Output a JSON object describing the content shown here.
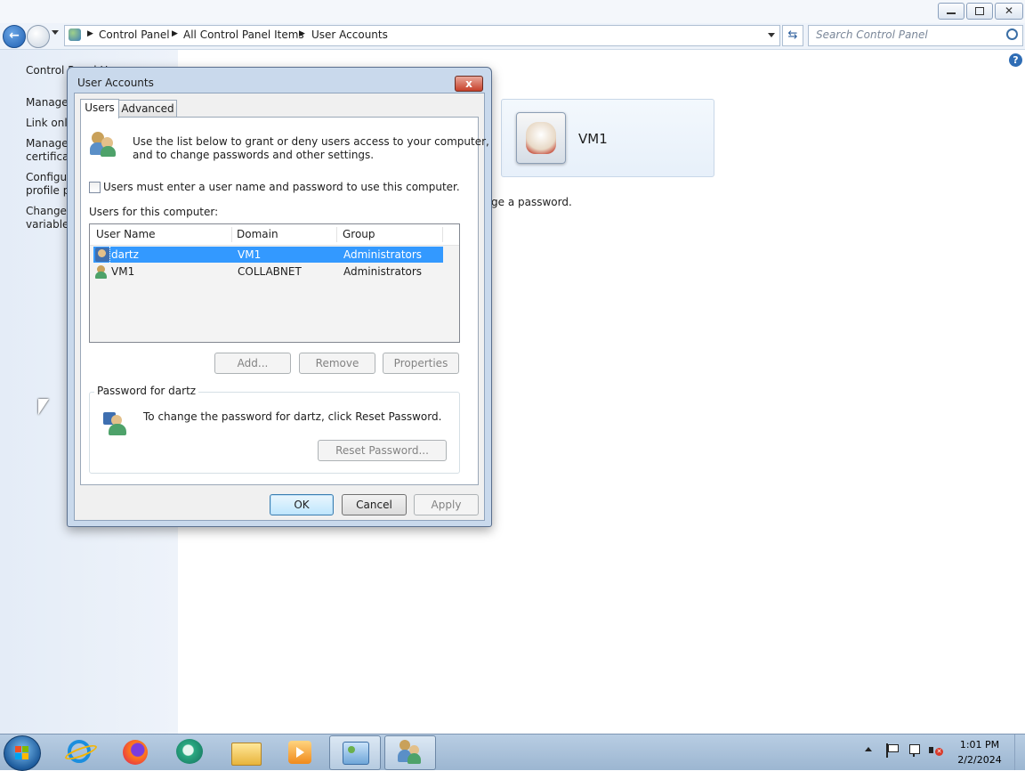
{
  "address": {
    "crumbs": [
      "Control Panel",
      "All Control Panel Items",
      "User Accounts"
    ],
    "search_placeholder": "Search Control Panel"
  },
  "left_pane": {
    "items": [
      "Control Panel Home",
      "Manage",
      "Link onli",
      "Manage",
      "certificat",
      "Configur",
      "profile pr",
      "Change",
      "variables"
    ]
  },
  "main": {
    "account_name": "VM1",
    "change_password_fragment": "ge a password."
  },
  "dialog": {
    "title": "User Accounts",
    "close_label": "x",
    "tabs": [
      "Users",
      "Advanced"
    ],
    "intro_line1": "Use the list below to grant or deny users access to your computer,",
    "intro_line2": "and to change passwords and other settings.",
    "require_login_label": "Users must enter a user name and password to use this computer.",
    "require_login_checked": false,
    "users_label": "Users for this computer:",
    "columns": [
      "User Name",
      "Domain",
      "Group"
    ],
    "users": [
      {
        "name": "dartz",
        "domain": "VM1",
        "group": "Administrators",
        "selected": true
      },
      {
        "name": "VM1",
        "domain": "COLLABNET",
        "group": "Administrators",
        "selected": false
      }
    ],
    "buttons": {
      "add": "Add...",
      "remove": "Remove",
      "properties": "Properties"
    },
    "password_group_title": "Password for dartz",
    "password_text": "To change the password for dartz, click Reset Password.",
    "reset_password": "Reset Password...",
    "ok": "OK",
    "cancel": "Cancel",
    "apply": "Apply"
  },
  "taskbar": {
    "time": "1:01 PM",
    "date": "2/2/2024",
    "apps": [
      "internet-explorer-icon",
      "firefox-icon",
      "chat-icon",
      "file-explorer-icon",
      "media-player-icon",
      "control-panel-icon",
      "user-accounts-icon"
    ]
  },
  "colors": {
    "selection": "#3399ff",
    "taskbar": "#b8cde3",
    "left_pane": "#e4ecf7"
  }
}
